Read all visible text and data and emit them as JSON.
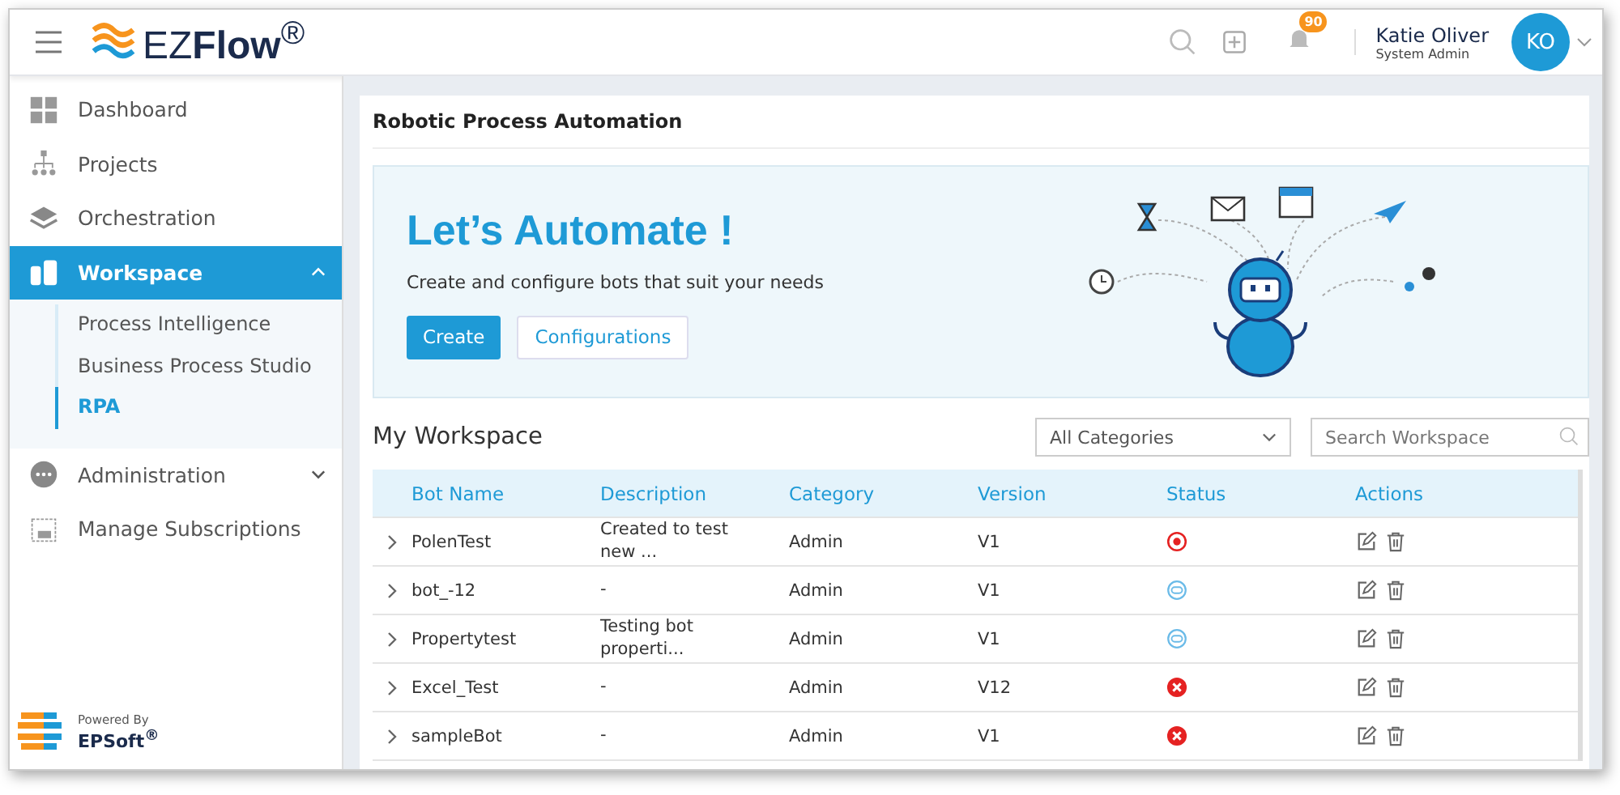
{
  "header": {
    "logo": "EZ**Flow**$^{®}$",
    "notifications": "90",
    "user": {
      "name": "Katie Oliver",
      "role": "System Admin",
      "initials": "KO"
    }
  },
  "sidebar": {
    "items": [
      {
        "label": "Dashboard",
        "selected": false
      },
      {
        "label": "Projects",
        "selected": false
      },
      {
        "label": "Orchestration",
        "selected": false
      },
      {
        "label": "Workspace",
        "selected": true,
        "expanded": true,
        "children": [
          {
            "label": "Process Intelligence",
            "selected": false
          },
          {
            "label": "Business Process Studio",
            "selected": false
          },
          {
            "label": "RPA",
            "selected": true
          }
        ]
      },
      {
        "label": "Administration",
        "selected": false,
        "expanded": false
      },
      {
        "label": "Manage Subscriptions",
        "selected": false
      }
    ],
    "powered_by": "Powered By",
    "brand": "EPSoft$^{®}$"
  },
  "page": {
    "title": "Robotic Process Automation",
    "hero": {
      "heading": "Let’s Automate !",
      "subtitle": "Create and configure bots that suit your needs",
      "buttons": [
        "Create",
        "Configurations"
      ]
    },
    "workspace": {
      "title": "My Workspace",
      "category_filter": "All Categories",
      "search": {
        "placeholder": "Search Workspace"
      },
      "table": {
        "columns": [
          "Bot Name",
          "Description",
          "Category",
          "Version",
          "Status",
          "Actions"
        ],
        "rows": [
          {
            "name": "PolenTest",
            "description": "Created to test new ...",
            "category": "Admin",
            "version": "V1",
            "kind": "stopped"
          },
          {
            "name": "bot_-12",
            "description": "-",
            "category": "Admin",
            "version": "V1",
            "kind": "idle"
          },
          {
            "name": "Propertytest",
            "description": "Testing bot properti...",
            "category": "Admin",
            "version": "V1",
            "kind": "idle"
          },
          {
            "name": "Excel_Test",
            "description": "-",
            "category": "Admin",
            "version": "V12",
            "kind": "error"
          },
          {
            "name": "sampleBot",
            "description": "-",
            "category": "Admin",
            "version": "V1",
            "kind": "error"
          }
        ]
      }
    }
  }
}
